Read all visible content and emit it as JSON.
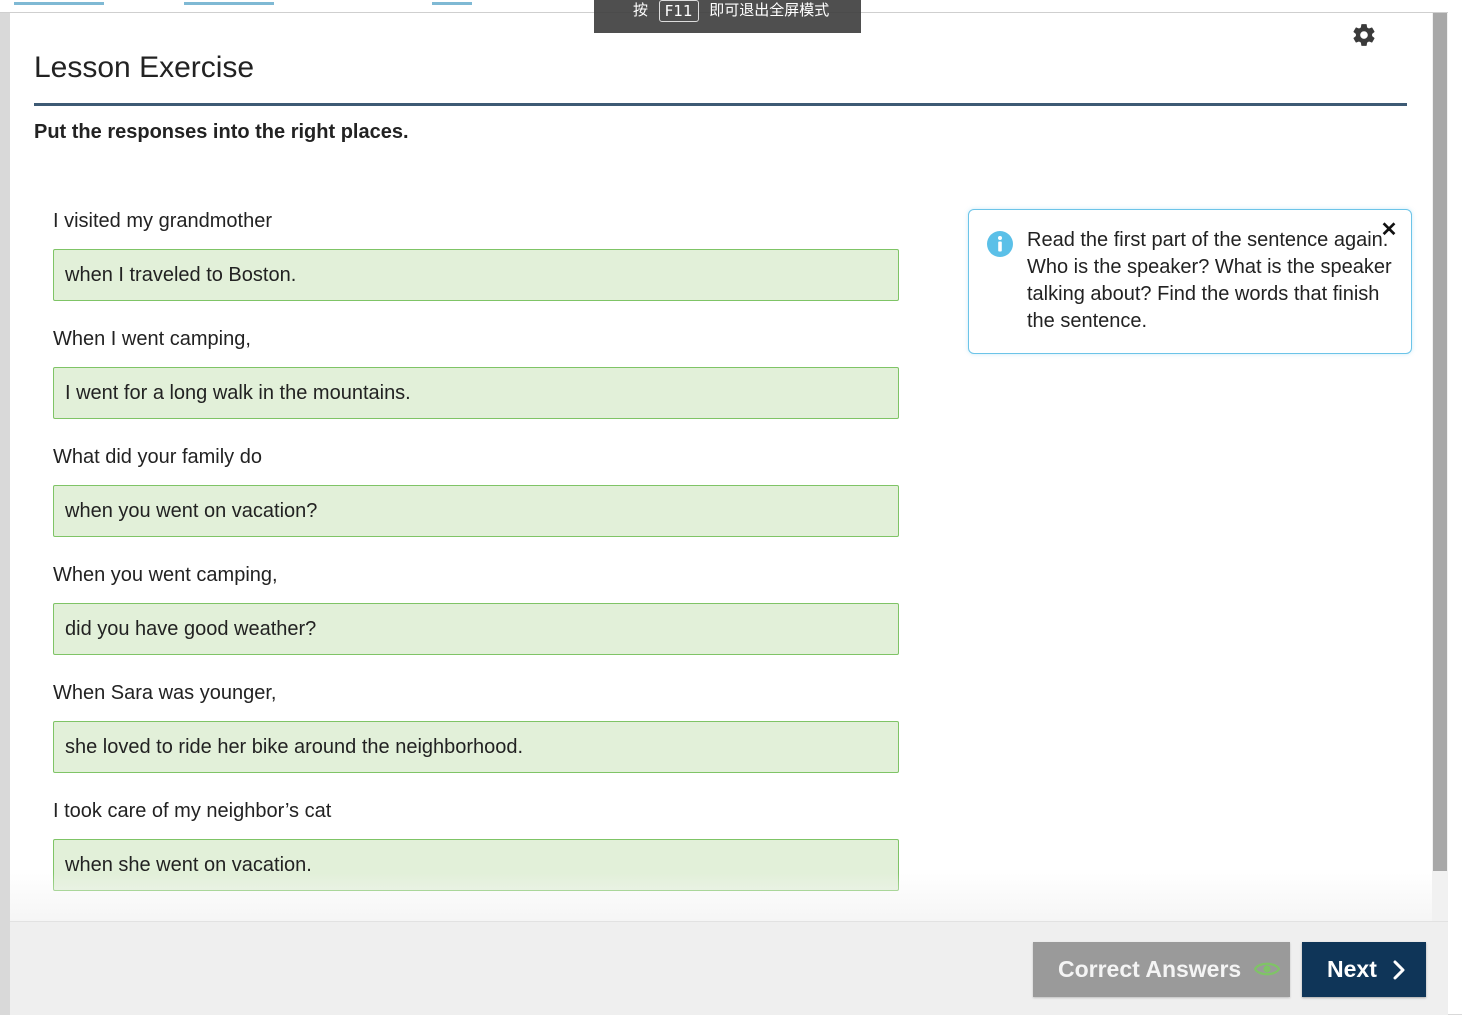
{
  "header": {
    "title": "Lesson Exercise",
    "instructions": "Put the responses into the right places."
  },
  "fullscreen_notice": {
    "prefix": "按",
    "key": "F11",
    "suffix": "即可退出全屏模式"
  },
  "items": [
    {
      "prompt": "I visited my grandmother",
      "response": "when I traveled to Boston."
    },
    {
      "prompt": "When I went camping,",
      "response": "I went for a long walk in the mountains."
    },
    {
      "prompt": "What did your family do",
      "response": "when you went on vacation?"
    },
    {
      "prompt": "When you went camping,",
      "response": "did you have good weather?"
    },
    {
      "prompt": "When Sara was younger,",
      "response": "she loved to ride her bike around the neighborhood."
    },
    {
      "prompt": "I took care of my neighbor’s cat",
      "response": "when she went on vacation."
    }
  ],
  "hint": {
    "text": "Read the first part of the sentence again. Who is the speaker? What is the speaker talking about?  Find the words that finish the sentence.",
    "close_label": "✕",
    "icon": "info-icon"
  },
  "footer": {
    "correct_answers_label": "Correct Answers",
    "next_label": "Next"
  },
  "colors": {
    "title_rule": "#3d5a74",
    "drop_fill": "#e2f0d9",
    "drop_border": "#7fc466",
    "hint_border": "#6cc4e8",
    "next_button": "#0f3558",
    "correct_button": "#9a9a9a",
    "eye_icon": "#7fc466"
  }
}
